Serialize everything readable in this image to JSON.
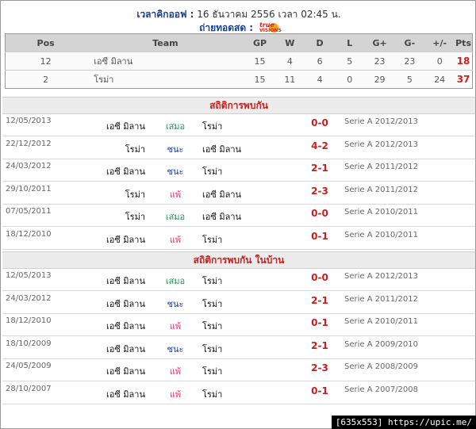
{
  "header": {
    "kickoff_label": "เวลาคิกออฟ :",
    "kickoff_value": "16 ธันวาคม 2556 เวลา 02:45 น.",
    "live_label": "ถ่ายทอดสด :",
    "channel_logo_text_top": "true",
    "channel_logo_text_bottom": "VISIONS",
    "channel_logo_color": "#e2231a"
  },
  "standings": {
    "columns": [
      "Pos",
      "Team",
      "GP",
      "W",
      "D",
      "L",
      "G+",
      "G-",
      "+/-",
      "Pts"
    ],
    "rows": [
      {
        "pos": "12",
        "team": "เอซี มิลาน",
        "gp": "15",
        "w": "4",
        "d": "6",
        "l": "5",
        "gf": "23",
        "ga": "23",
        "diff": "0",
        "pts": "18"
      },
      {
        "pos": "2",
        "team": "โรม่า",
        "gp": "15",
        "w": "11",
        "d": "4",
        "l": "0",
        "gf": "29",
        "ga": "5",
        "diff": "24",
        "pts": "37"
      }
    ]
  },
  "h2h": {
    "title": "สถิติการพบกัน",
    "matches": [
      {
        "date": "12/05/2013",
        "home": "เอซี มิลาน",
        "result": "เสมอ",
        "away": "โรม่า",
        "score": "0-0",
        "comp": "Serie A 2012/2013"
      },
      {
        "date": "22/12/2012",
        "home": "โรม่า",
        "result": "ชนะ",
        "away": "เอซี มิลาน",
        "score": "4-2",
        "comp": "Serie A 2012/2013"
      },
      {
        "date": "24/03/2012",
        "home": "เอซี มิลาน",
        "result": "ชนะ",
        "away": "โรม่า",
        "score": "2-1",
        "comp": "Serie A 2011/2012"
      },
      {
        "date": "29/10/2011",
        "home": "โรม่า",
        "result": "แพ้",
        "away": "เอซี มิลาน",
        "score": "2-3",
        "comp": "Serie A 2011/2012"
      },
      {
        "date": "07/05/2011",
        "home": "โรม่า",
        "result": "เสมอ",
        "away": "เอซี มิลาน",
        "score": "0-0",
        "comp": "Serie A 2010/2011"
      },
      {
        "date": "18/12/2010",
        "home": "เอซี มิลาน",
        "result": "แพ้",
        "away": "โรม่า",
        "score": "0-1",
        "comp": "Serie A 2010/2011"
      }
    ]
  },
  "h2h_home": {
    "title": "สถิติการพบกัน ในบ้าน",
    "matches": [
      {
        "date": "12/05/2013",
        "home": "เอซี มิลาน",
        "result": "เสมอ",
        "away": "โรม่า",
        "score": "0-0",
        "comp": "Serie A 2012/2013"
      },
      {
        "date": "24/03/2012",
        "home": "เอซี มิลาน",
        "result": "ชนะ",
        "away": "โรม่า",
        "score": "2-1",
        "comp": "Serie A 2011/2012"
      },
      {
        "date": "18/12/2010",
        "home": "เอซี มิลาน",
        "result": "แพ้",
        "away": "โรม่า",
        "score": "0-1",
        "comp": "Serie A 2010/2011"
      },
      {
        "date": "18/10/2009",
        "home": "เอซี มิลาน",
        "result": "ชนะ",
        "away": "โรม่า",
        "score": "2-1",
        "comp": "Serie A 2009/2010"
      },
      {
        "date": "24/05/2009",
        "home": "เอซี มิลาน",
        "result": "แพ้",
        "away": "โรม่า",
        "score": "2-3",
        "comp": "Serie A 2008/2009"
      },
      {
        "date": "28/10/2007",
        "home": "เอซี มิลาน",
        "result": "แพ้",
        "away": "โรม่า",
        "score": "0-1",
        "comp": "Serie A 2007/2008"
      }
    ]
  },
  "result_colors": {
    "เสมอ": "#1d9a52",
    "ชนะ": "#1a3fa8",
    "แพ้": "#e0337a"
  },
  "watermark": "[635x553] https://upic.me/"
}
